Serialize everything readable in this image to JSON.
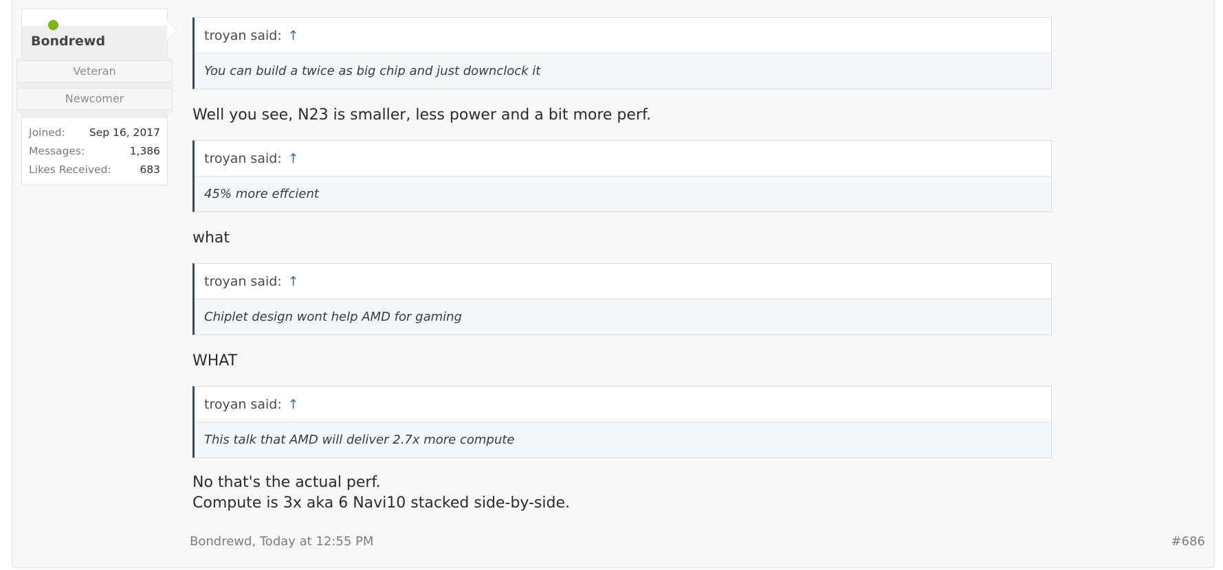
{
  "user": {
    "name": "Bondrewd",
    "titles": [
      "Veteran",
      "Newcomer"
    ],
    "stats": [
      {
        "label": "Joined:",
        "value": "Sep 16, 2017"
      },
      {
        "label": "Messages:",
        "value": "1,386"
      },
      {
        "label": "Likes Received:",
        "value": "683"
      }
    ],
    "online_color": "#7cb518"
  },
  "message": {
    "blocks": [
      {
        "quote_author": "troyan said:",
        "quote_link": "↑",
        "quote_text": "You can build a twice as big chip and just downclock it",
        "reply": [
          "Well you see, N23 is smaller, less power and a bit more perf."
        ]
      },
      {
        "quote_author": "troyan said:",
        "quote_link": "↑",
        "quote_text": "45% more effcient",
        "reply": [
          "what"
        ]
      },
      {
        "quote_author": "troyan said:",
        "quote_link": "↑",
        "quote_text": "Chiplet design wont help AMD for gaming",
        "reply": [
          "WHAT"
        ]
      },
      {
        "quote_author": "troyan said:",
        "quote_link": "↑",
        "quote_text": "This talk that AMD will deliver 2.7x more compute",
        "reply": [
          "No that's the actual perf.",
          "Compute is 3x aka 6 Navi10 stacked side-by-side."
        ]
      }
    ]
  },
  "footer": {
    "author_time": "Bondrewd, Today at 12:55 PM",
    "post_number": "#686"
  }
}
